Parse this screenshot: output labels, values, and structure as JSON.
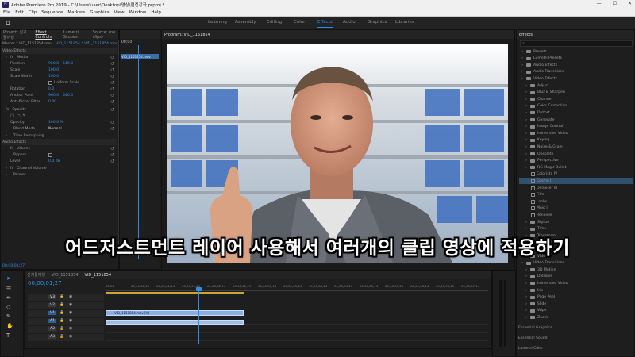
{
  "window": {
    "title": "Adobe Premiere Pro 2019 - C:\\Users\\user\\Desktop\\영상\\편집강좌.prproj *",
    "min": "—",
    "max": "☐",
    "close": "✕"
  },
  "menu": [
    "File",
    "Edit",
    "Clip",
    "Sequence",
    "Markers",
    "Graphics",
    "View",
    "Window",
    "Help"
  ],
  "workspaces": [
    "Learning",
    "Assembly",
    "Editing",
    "Color",
    "Effects",
    "Audio",
    "Graphics",
    "Libraries"
  ],
  "active_workspace": "Effects",
  "left_panel": {
    "tabs": [
      "Project: 신기툴어행",
      "Effect Controls",
      "Lumetri Scopes",
      "Source: (no clips)"
    ],
    "master_label": "Master * VID_1151854.mov",
    "master_seq": "VID_1151854 * VID_1151854.mov",
    "timecode_top": "00;00",
    "clip_chip": "VID_1151854.mov",
    "video_effects": "Video Effects",
    "motion": "Motion",
    "position": {
      "label": "Position",
      "x": "960.0",
      "y": "540.0"
    },
    "scale": {
      "label": "Scale",
      "value": "100.0"
    },
    "scale_width": {
      "label": "Scale Width",
      "value": "100.0"
    },
    "uniform": "Uniform Scale",
    "rotation": {
      "label": "Rotation",
      "value": "0.0"
    },
    "anchor": {
      "label": "Anchor Point",
      "x": "960.0",
      "y": "540.0"
    },
    "antiflicker": {
      "label": "Anti-flicker Filter",
      "value": "0.00"
    },
    "opacity": "Opacity",
    "opacity_value": {
      "label": "Opacity",
      "value": "100.0 %"
    },
    "blend": {
      "label": "Blend Mode",
      "value": "Normal"
    },
    "time_remap": "Time Remapping",
    "audio_effects": "Audio Effects",
    "volume": "Volume",
    "bypass": "Bypass",
    "level": {
      "label": "Level",
      "value": "0.0 dB"
    },
    "channel_volume": "Channel Volume",
    "panner": "Panner",
    "bottom_timecode": "00;00;01;27"
  },
  "program": {
    "title": "Program: VID_1151854"
  },
  "subtitle": "어드저스트먼트 레이어 사용해서 여러개의 클립 영상에 적용하기",
  "effects_panel": {
    "title": "Effects",
    "search_placeholder": "",
    "items": [
      {
        "label": "Presets",
        "indent": 1
      },
      {
        "label": "Lumetri Presets",
        "indent": 1
      },
      {
        "label": "Audio Effects",
        "indent": 1
      },
      {
        "label": "Audio Transitions",
        "indent": 1
      },
      {
        "label": "Video Effects",
        "indent": 1
      },
      {
        "label": "Adjust",
        "indent": 2
      },
      {
        "label": "Blur & Sharpen",
        "indent": 2
      },
      {
        "label": "Channel",
        "indent": 2
      },
      {
        "label": "Color Correction",
        "indent": 2
      },
      {
        "label": "Distort",
        "indent": 2
      },
      {
        "label": "Generate",
        "indent": 2
      },
      {
        "label": "Image Control",
        "indent": 2
      },
      {
        "label": "Immersive Video",
        "indent": 2
      },
      {
        "label": "Keying",
        "indent": 2
      },
      {
        "label": "Noise & Grain",
        "indent": 2
      },
      {
        "label": "Obsolete",
        "indent": 2
      },
      {
        "label": "Perspective",
        "indent": 2
      },
      {
        "label": "RG Magic Bullet",
        "indent": 2
      },
      {
        "label": "Colorista IV",
        "indent": 3
      },
      {
        "label": "Cosmo II",
        "indent": 3
      },
      {
        "label": "Denoiser III",
        "indent": 3
      },
      {
        "label": "Film",
        "indent": 3
      },
      {
        "label": "Looks",
        "indent": 3
      },
      {
        "label": "Mojo II",
        "indent": 3
      },
      {
        "label": "Renoiser",
        "indent": 3
      },
      {
        "label": "Stylize",
        "indent": 2
      },
      {
        "label": "Time",
        "indent": 2
      },
      {
        "label": "Transform",
        "indent": 2
      },
      {
        "label": "Transition",
        "indent": 2
      },
      {
        "label": "Utility",
        "indent": 2
      },
      {
        "label": "Video",
        "indent": 2
      },
      {
        "label": "Video Transitions",
        "indent": 1
      },
      {
        "label": "3D Motion",
        "indent": 2
      },
      {
        "label": "Dissolve",
        "indent": 2
      },
      {
        "label": "Immersive Video",
        "indent": 2
      },
      {
        "label": "Iris",
        "indent": 2
      },
      {
        "label": "Page Peel",
        "indent": 2
      },
      {
        "label": "Slide",
        "indent": 2
      },
      {
        "label": "Wipe",
        "indent": 2
      },
      {
        "label": "Zoom",
        "indent": 2
      }
    ],
    "footer": [
      "Essential Graphics",
      "Essential Sound",
      "Lumetri Color"
    ]
  },
  "timeline": {
    "tabs": [
      "신기툴어행",
      "VID_1151854",
      "VID_1151854"
    ],
    "timecode": "00;00;01;27",
    "ruler": [
      "00;00",
      "00;00;00;29",
      "00;00;01;14",
      "00;00;01;29",
      "00;00;02;14",
      "00;00;02;29",
      "00;00;03;14",
      "00;00;03;29",
      "00;00;04;14",
      "00;00;04;29",
      "00;00;05;14",
      "00;00;05;29",
      "00;00;06;14",
      "00;00;06;29",
      "00;00;07;14"
    ],
    "video_tracks": [
      "V3",
      "V2",
      "V1"
    ],
    "audio_tracks": [
      "A1",
      "A2",
      "A3"
    ],
    "video_clip": "VID_1151854.mov [V]",
    "audio_clip": ""
  },
  "colors": {
    "accent": "#2d8ceb",
    "clip": "#8ab0e0"
  }
}
